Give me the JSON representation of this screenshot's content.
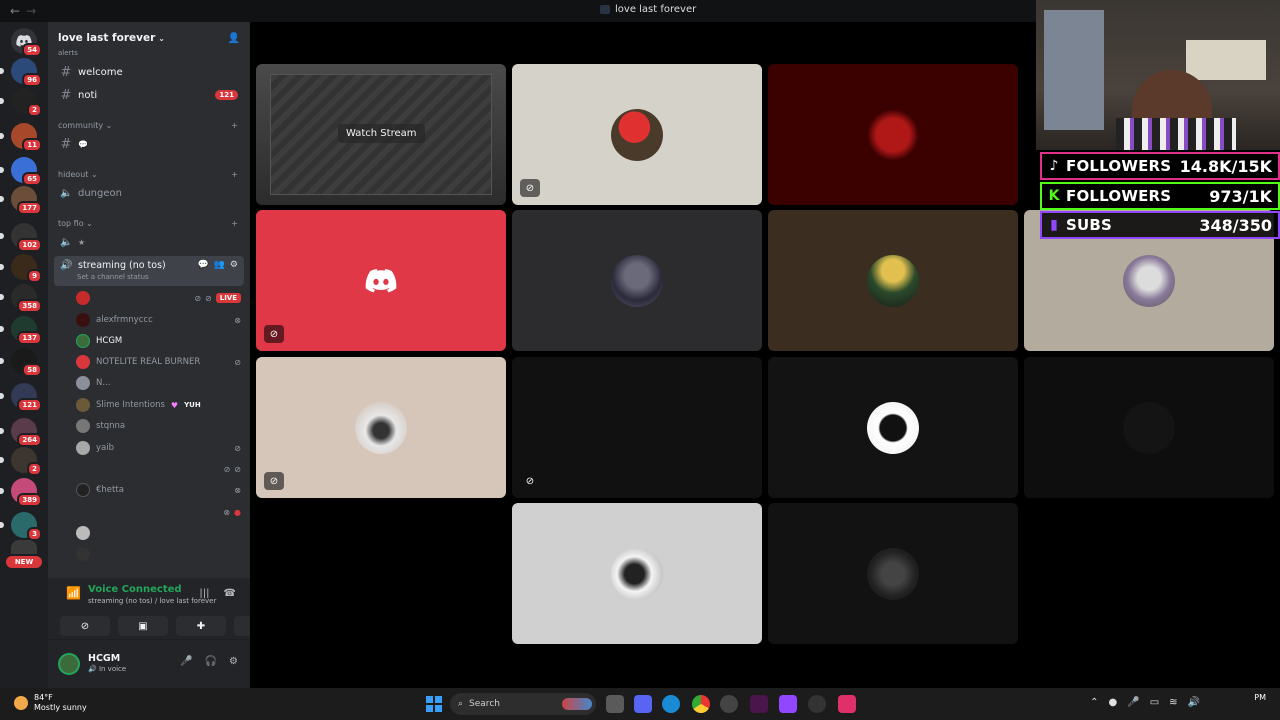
{
  "window": {
    "title": "love last forever"
  },
  "rail": {
    "servers": [
      {
        "badge": "54",
        "color": "#5865f2"
      },
      {
        "badge": "96",
        "color": "#2b4a7a"
      },
      {
        "badge": "2",
        "color": "#222"
      },
      {
        "badge": "11",
        "color": "#a8482b"
      },
      {
        "badge": "65",
        "color": "#3a6fd8"
      },
      {
        "badge": "177",
        "color": "#6b4d3a"
      },
      {
        "badge": "102",
        "color": "#333"
      },
      {
        "badge": "9",
        "color": "#3a2a1a"
      },
      {
        "badge": "358",
        "color": "#2a2a2a"
      },
      {
        "badge": "137",
        "color": "#1f3a2f"
      },
      {
        "badge": "58",
        "color": "#1a1a1a"
      },
      {
        "badge": "121",
        "color": "#333a55"
      },
      {
        "badge": "264",
        "color": "#5a3b4a"
      },
      {
        "badge": "2",
        "color": "#3d3530"
      },
      {
        "badge": "389",
        "color": "#c44a7a"
      },
      {
        "badge": "3",
        "color": "#2a6a6a"
      }
    ],
    "new_label": "NEW"
  },
  "sidebar": {
    "guild_name": "love last forever",
    "partial_top": "alerts",
    "channels": [
      {
        "name": "welcome"
      },
      {
        "name": "noti",
        "badge": "121"
      }
    ],
    "cat_community": "community",
    "community_channel_icon": "💬",
    "cat_hideout": "hideout",
    "hideout_channel": "dungeon",
    "cat_topflo": "top flo",
    "topflo_channel": "★",
    "voice_channel": "streaming (no tos)",
    "voice_channel_status": "Set a channel status",
    "live_label": "LIVE",
    "voice_users": [
      {
        "name": "",
        "live": true
      },
      {
        "name": "alexfrmnyccc"
      },
      {
        "name": "HCGM"
      },
      {
        "name": "NOTELITE REAL BURNER"
      },
      {
        "name": "N..."
      },
      {
        "name": "Slime Intentions",
        "tag": "YUH"
      },
      {
        "name": "stqnna"
      },
      {
        "name": "yaib"
      },
      {
        "name": ""
      },
      {
        "name": "€hetta"
      },
      {
        "name": ""
      },
      {
        "name": ""
      },
      {
        "name": ""
      }
    ]
  },
  "voice_panel": {
    "title": "Voice Connected",
    "subtitle": "streaming (no tos) / love last forever"
  },
  "user_panel": {
    "name": "HCGM",
    "status": "In voice"
  },
  "stage": {
    "watch_label": "Watch Stream"
  },
  "overlay": {
    "stats": [
      {
        "icon": "tiktok-icon",
        "label": "FOLLOWERS",
        "value": "14.8K/15K",
        "color": "#e0308a"
      },
      {
        "icon": "kick-icon",
        "label": "FOLLOWERS",
        "value": "973/1K",
        "color": "#53fc18"
      },
      {
        "icon": "twitch-icon",
        "label": "SUBS",
        "value": "348/350",
        "color": "#9146ff"
      }
    ]
  },
  "taskbar": {
    "temp": "84°F",
    "weather": "Mostly sunny",
    "search_placeholder": "Search",
    "clock_time": "PM"
  }
}
